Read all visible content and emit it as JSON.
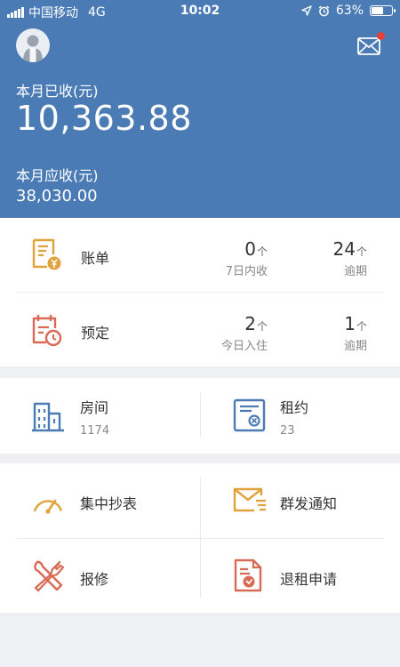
{
  "status_bar": {
    "carrier": "中国移动",
    "network": "4G",
    "time": "10:02",
    "battery": "63%",
    "battery_level": 0.63
  },
  "header": {
    "received_label": "本月已收(元)",
    "received_amount": "10,363.88",
    "due_label": "本月应收(元)",
    "due_amount": "38,030.00",
    "has_unread_mail": true
  },
  "bills": {
    "title": "账单",
    "stat1": {
      "value": "0",
      "unit": "个",
      "label": "7日内收"
    },
    "stat2": {
      "value": "24",
      "unit": "个",
      "label": "逾期"
    }
  },
  "booking": {
    "title": "预定",
    "stat1": {
      "value": "2",
      "unit": "个",
      "label": "今日入住"
    },
    "stat2": {
      "value": "1",
      "unit": "个",
      "label": "逾期"
    }
  },
  "rooms": {
    "title": "房间",
    "count": "1174"
  },
  "leases": {
    "title": "租约",
    "count": "23"
  },
  "tools": [
    {
      "label": "集中抄表",
      "icon": "meter-icon"
    },
    {
      "label": "群发通知",
      "icon": "broadcast-mail-icon"
    },
    {
      "label": "报修",
      "icon": "repair-tools-icon"
    },
    {
      "label": "退租申请",
      "icon": "checkout-document-icon"
    }
  ],
  "colors": {
    "header_bg": "#4a7bb5",
    "orange_icon": "#e0a23a",
    "red_icon": "#d96a55",
    "blue_icon": "#4a7bb5",
    "badge_red": "#e5403a",
    "page_bg": "#eff0f4"
  }
}
